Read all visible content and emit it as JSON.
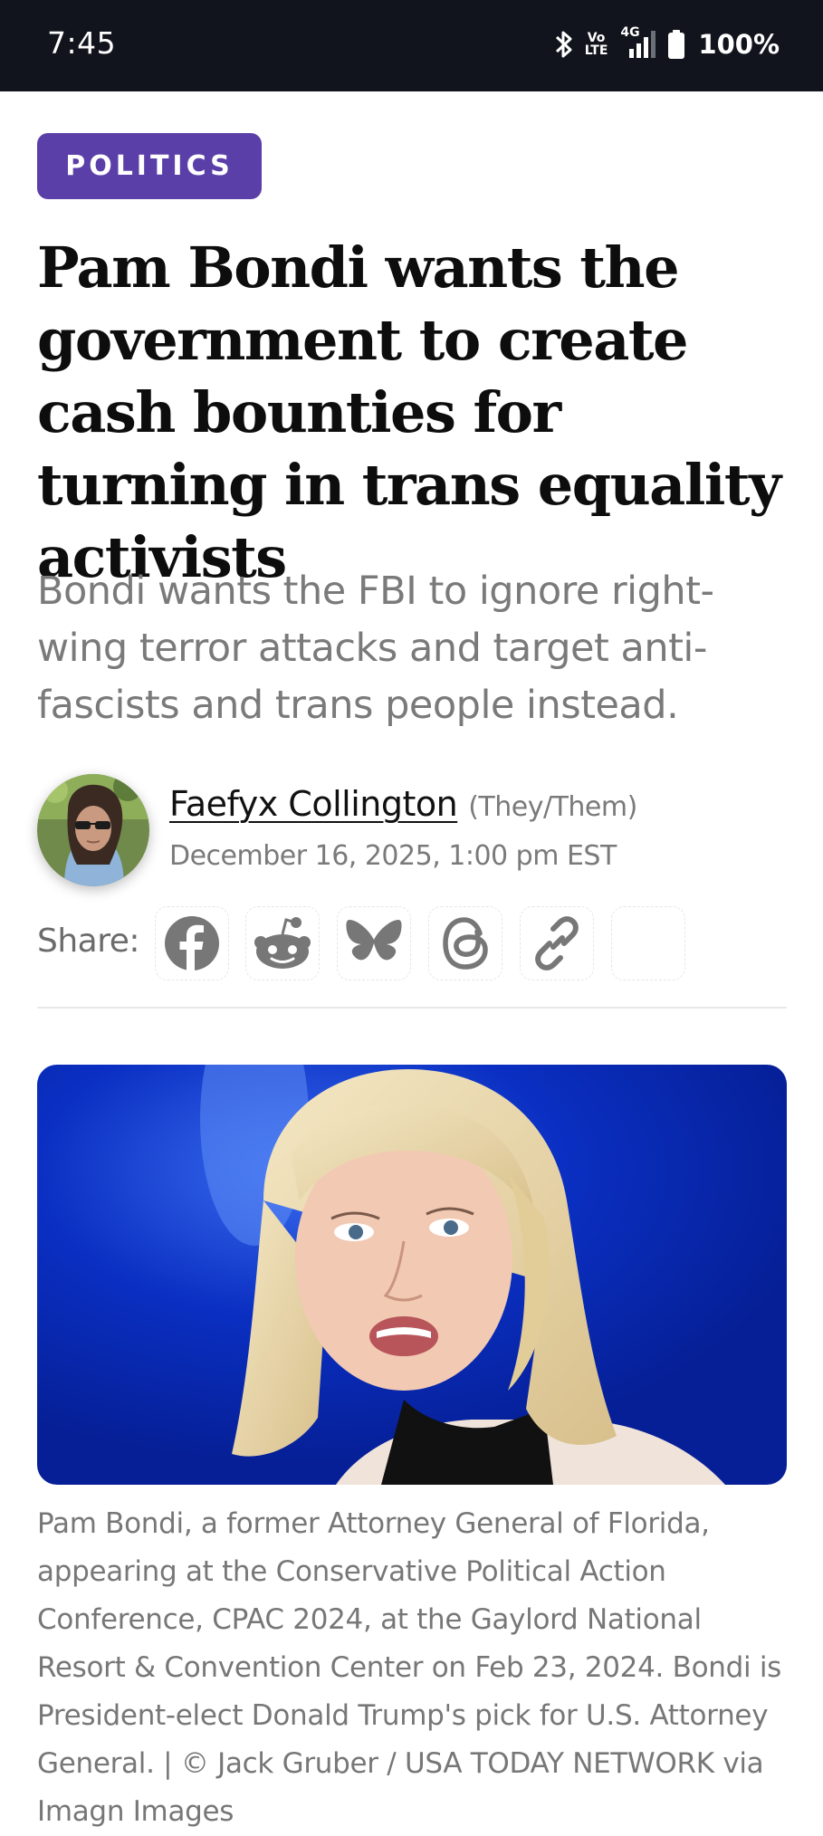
{
  "status_bar": {
    "time": "7:45",
    "volte_top": "Vo",
    "volte_bottom": "LTE",
    "network": "4G",
    "battery": "100%",
    "icons": [
      "bluetooth-icon",
      "volte-icon",
      "signal-icon",
      "battery-icon"
    ]
  },
  "article": {
    "category": "POLITICS",
    "headline": "Pam Bondi wants the government to create cash bounties for turning in trans equality activists",
    "dek": "Bondi wants the FBI to ignore right-wing terror attacks and target anti-fascists and trans people instead.",
    "author": {
      "name": "Faefyx Collington",
      "pronouns": "(They/Them)",
      "date": "December 16, 2025, 1:00 pm EST"
    },
    "share": {
      "label": "Share:",
      "buttons": [
        "facebook-icon",
        "reddit-icon",
        "bluesky-icon",
        "threads-icon",
        "link-icon",
        "empty"
      ]
    },
    "hero_caption": "Pam Bondi, a former Attorney General of Florida, appearing at the Conservative Political Action Conference, CPAC 2024, at the Gaylord National Resort & Convention Center on Feb 23, 2024. Bondi is President-elect Donald Trump's pick for U.S. Attorney General. | © Jack Gruber / USA TODAY NETWORK via Imagn Images"
  },
  "colors": {
    "status_bar_bg": "#11141c",
    "badge_bg": "#5b3fa8",
    "headline": "#0d0d0d",
    "muted_text": "#7a7a7a",
    "hero_bg": "#0b2fb0"
  }
}
